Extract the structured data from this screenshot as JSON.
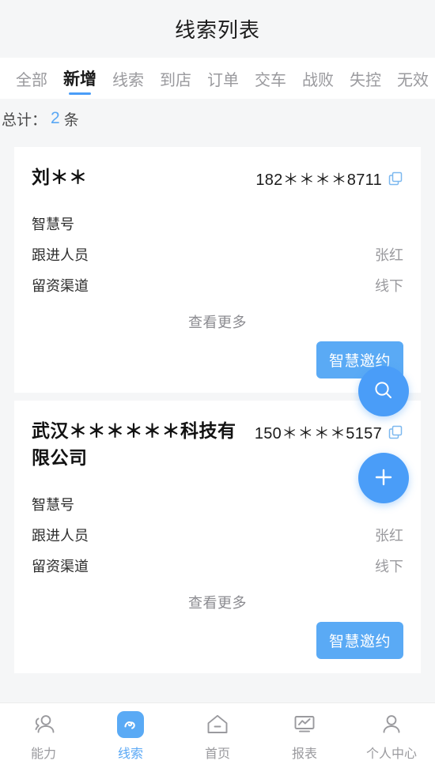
{
  "header": {
    "title": "线索列表"
  },
  "tabs": [
    {
      "label": "全部",
      "active": false
    },
    {
      "label": "新增",
      "active": true
    },
    {
      "label": "线索",
      "active": false
    },
    {
      "label": "到店",
      "active": false
    },
    {
      "label": "订单",
      "active": false
    },
    {
      "label": "交车",
      "active": false
    },
    {
      "label": "战败",
      "active": false
    },
    {
      "label": "失控",
      "active": false
    },
    {
      "label": "无效",
      "active": false
    }
  ],
  "summary": {
    "prefix": "总计：",
    "count": "2",
    "suffix": "条"
  },
  "cards": [
    {
      "name": "刘＊＊",
      "phone": "182＊＊＊＊8711",
      "copy_icon": "copy-icon",
      "fields": [
        {
          "label": "智慧号",
          "value": ""
        },
        {
          "label": "跟进人员",
          "value": "张红"
        },
        {
          "label": "留资渠道",
          "value": "线下"
        }
      ],
      "view_more": "查看更多",
      "action_label": "智慧邀约"
    },
    {
      "name": "武汉＊＊＊＊＊＊科技有限公司",
      "phone": "150＊＊＊＊5157",
      "copy_icon": "copy-icon",
      "fields": [
        {
          "label": "智慧号",
          "value": ""
        },
        {
          "label": "跟进人员",
          "value": "张红"
        },
        {
          "label": "留资渠道",
          "value": "线下"
        }
      ],
      "view_more": "查看更多",
      "action_label": "智慧邀约"
    }
  ],
  "fabs": {
    "search_icon": "search-icon",
    "add_icon": "plus-icon"
  },
  "bottom_nav": [
    {
      "label": "能力",
      "icon": "people-group-icon",
      "active": false
    },
    {
      "label": "线索",
      "icon": "clue-wave-icon",
      "active": true
    },
    {
      "label": "首页",
      "icon": "home-icon",
      "active": false
    },
    {
      "label": "报表",
      "icon": "report-monitor-icon",
      "active": false
    },
    {
      "label": "个人中心",
      "icon": "person-icon",
      "active": false
    }
  ],
  "colors": {
    "accent": "#4a9df8",
    "accent_soft": "#5aaaf5",
    "page_bg": "#f5f6f7",
    "card_bg": "#ffffff",
    "muted_text": "#9a9a9e",
    "primary_text": "#1b1b1b"
  }
}
